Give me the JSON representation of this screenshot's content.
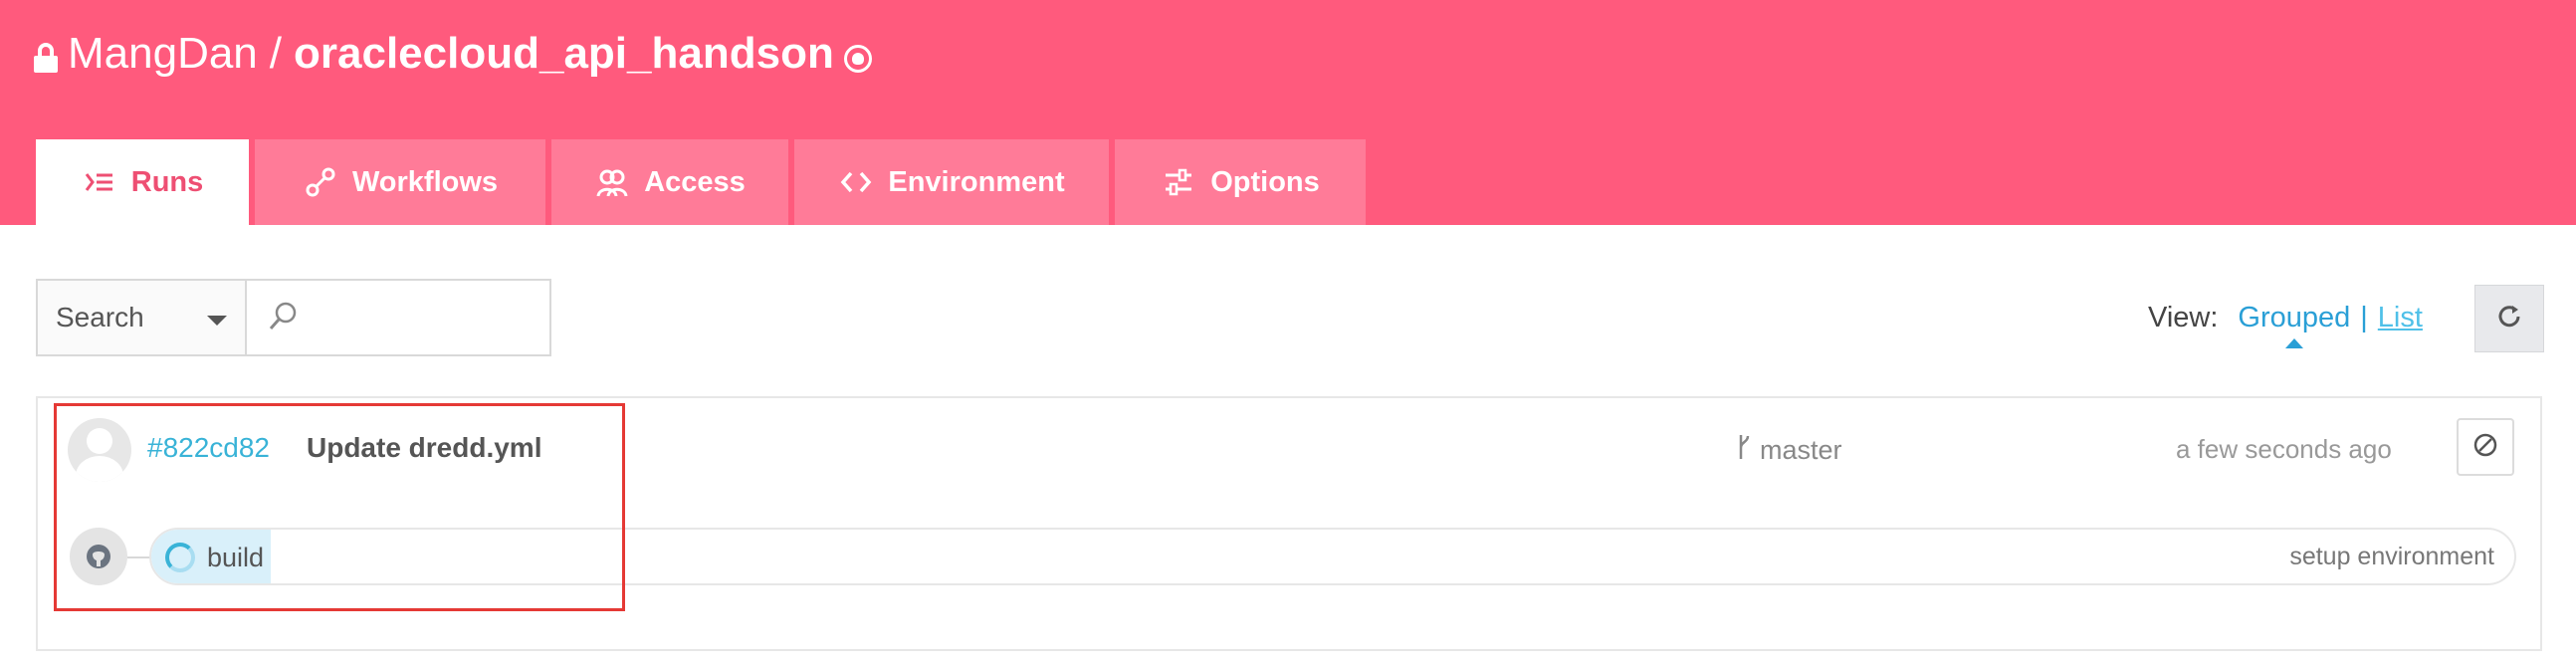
{
  "repo": {
    "owner": "MangDan",
    "separator": "/",
    "name": "oraclecloud_api_handson"
  },
  "tabs": [
    {
      "label": "Runs",
      "icon": "runs-icon",
      "active": true
    },
    {
      "label": "Workflows",
      "icon": "workflows-icon",
      "active": false
    },
    {
      "label": "Access",
      "icon": "access-icon",
      "active": false
    },
    {
      "label": "Environment",
      "icon": "code-icon",
      "active": false
    },
    {
      "label": "Options",
      "icon": "options-icon",
      "active": false
    }
  ],
  "search": {
    "selected": "Search",
    "placeholder": ""
  },
  "view": {
    "label": "View:",
    "grouped": "Grouped",
    "separator": "|",
    "list": "List",
    "active": "Grouped"
  },
  "run": {
    "hash": "#822cd82",
    "message": "Update dredd.yml",
    "branch": "master",
    "time": "a few seconds ago",
    "job": {
      "name": "build",
      "step": "setup environment",
      "status": "running"
    }
  },
  "colors": {
    "header": "#ff5a7d",
    "tab": "#ff7b98",
    "accent": "#39b3d7",
    "highlight": "#e53935"
  }
}
